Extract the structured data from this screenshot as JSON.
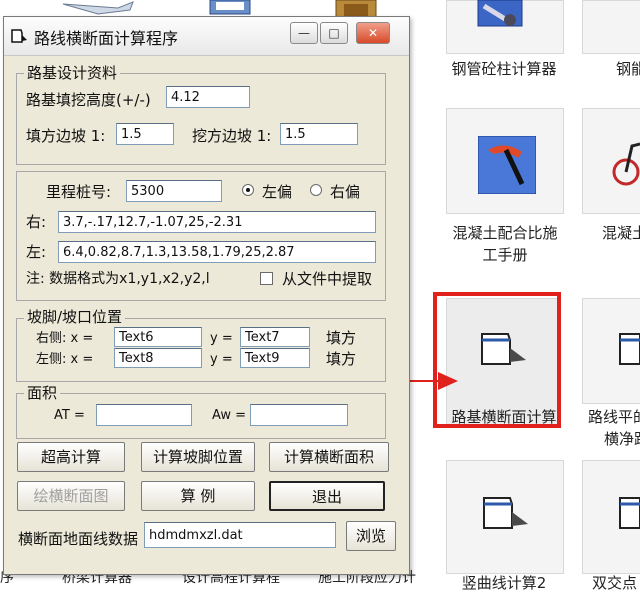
{
  "window": {
    "title": "路线横断面计算程序",
    "min_glyph": "—",
    "max_glyph": "□",
    "close_glyph": "✕"
  },
  "subgrade": {
    "legend": "路基设计资料",
    "fill_height_label": "路基填挖高度(+/-)",
    "fill_height_value": "4.12",
    "fill_slope_label": "填方边坡 1:",
    "fill_slope_value": "1.5",
    "cut_slope_label": "挖方边坡 1:",
    "cut_slope_value": "1.5"
  },
  "station": {
    "label": "里程桩号:",
    "value": "5300",
    "left_offset_label": "左偏",
    "right_offset_label": "右偏",
    "right_label": "右:",
    "right_value": "3.7,-.17,12.7,-1.07,25,-2.31",
    "left_label": "左:",
    "left_value": "6.4,0.82,8.7,1.3,13.58,1.79,25,2.87",
    "note": "注: 数据格式为x1,y1,x2,y2,l",
    "from_file_label": "从文件中提取"
  },
  "slope_foot": {
    "legend": "坡脚/坡口位置",
    "right_side_label": "右侧: x =",
    "left_side_label": "左侧: x =",
    "y_label": "y =",
    "right_x": "Text6",
    "right_y": "Text7",
    "left_x": "Text8",
    "left_y": "Text9",
    "right_type": "填方",
    "left_type": "填方"
  },
  "area": {
    "legend": "面积",
    "at_label": "AT =",
    "aw_label": "Aw =",
    "at_value": "",
    "aw_value": ""
  },
  "buttons": {
    "superelevation": "超高计算",
    "calc_foot": "计算坡脚位置",
    "calc_area": "计算横断面积",
    "draw": "绘横断面图",
    "example": "算 例",
    "exit": "退出",
    "browse": "浏览"
  },
  "ground_file": {
    "label": "横断面地面线数据",
    "value": "hdmdmxzl.dat"
  },
  "desktop": {
    "steel_column": "钢管砼柱计算器",
    "steel_partial": "钢能",
    "concrete_l1": "混凝土配合比施",
    "concrete_l2": "工手册",
    "concrete_partial": "混凝土",
    "cross_section": "路基横断面计算",
    "route_plane_l1": "路线平的",
    "route_plane_l2": "横净距",
    "vertical_curve": "竖曲线计算2",
    "intersection_partial": "双交点",
    "bottom_1": "序",
    "bottom_2": "桥梁计算器",
    "bottom_3": "设计高程计算程",
    "bottom_4": "施工阶段应力计",
    "accent": "#e0211c"
  }
}
